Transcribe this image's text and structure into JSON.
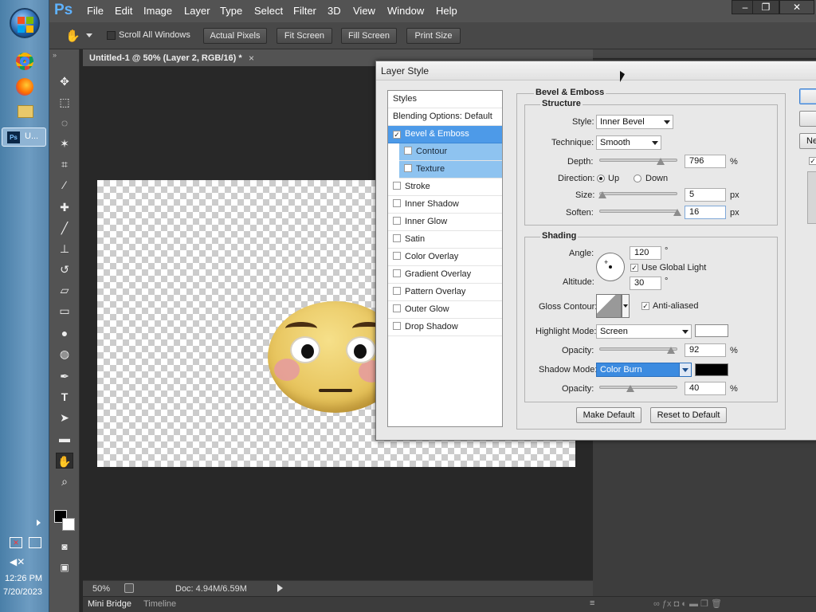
{
  "taskbar": {
    "task_label": "U...",
    "ps_badge": "Ps",
    "time": "12:26 PM",
    "date": "7/20/2023"
  },
  "app": {
    "logo": "Ps",
    "menus": [
      "File",
      "Edit",
      "Image",
      "Layer",
      "Type",
      "Select",
      "Filter",
      "3D",
      "View",
      "Window",
      "Help"
    ]
  },
  "options": {
    "scroll_all": "Scroll All Windows",
    "buttons": [
      "Actual Pixels",
      "Fit Screen",
      "Fill Screen",
      "Print Size"
    ]
  },
  "document": {
    "tab_title": "Untitled-1 @ 50% (Layer 2, RGB/16) *",
    "close": "×",
    "zoom": "50%",
    "doc_info": "Doc: 4.94M/6.59M"
  },
  "bottom_tabs": [
    "Mini Bridge",
    "Timeline"
  ],
  "dialog": {
    "title": "Layer Style",
    "list_header": "Styles",
    "blending": "Blending Options: Default",
    "items": [
      {
        "label": "Bevel & Emboss",
        "checked": "✓"
      },
      {
        "label": "Contour",
        "checked": ""
      },
      {
        "label": "Texture",
        "checked": ""
      },
      {
        "label": "Stroke",
        "checked": ""
      },
      {
        "label": "Inner Shadow",
        "checked": ""
      },
      {
        "label": "Inner Glow",
        "checked": ""
      },
      {
        "label": "Satin",
        "checked": ""
      },
      {
        "label": "Color Overlay",
        "checked": ""
      },
      {
        "label": "Gradient Overlay",
        "checked": ""
      },
      {
        "label": "Pattern Overlay",
        "checked": ""
      },
      {
        "label": "Outer Glow",
        "checked": ""
      },
      {
        "label": "Drop Shadow",
        "checked": ""
      }
    ],
    "section_title": "Bevel & Emboss",
    "structure": {
      "title": "Structure",
      "style_label": "Style:",
      "style_value": "Inner Bevel",
      "technique_label": "Technique:",
      "technique_value": "Smooth",
      "depth_label": "Depth:",
      "depth_value": "796",
      "depth_unit": "%",
      "direction_label": "Direction:",
      "up": "Up",
      "down": "Down",
      "size_label": "Size:",
      "size_value": "5",
      "size_unit": "px",
      "soften_label": "Soften:",
      "soften_value": "16",
      "soften_unit": "px"
    },
    "shading": {
      "title": "Shading",
      "angle_label": "Angle:",
      "angle_value": "120",
      "deg": "°",
      "global_light": "Use Global Light",
      "altitude_label": "Altitude:",
      "altitude_value": "30",
      "gloss_label": "Gloss Contour:",
      "anti_aliased": "Anti-aliased",
      "highlight_label": "Highlight Mode:",
      "highlight_value": "Screen",
      "hl_opacity_label": "Opacity:",
      "hl_opacity_value": "92",
      "pct": "%",
      "shadow_label": "Shadow Mode:",
      "shadow_value": "Color Burn",
      "sh_opacity_label": "Opacity:",
      "sh_opacity_value": "40"
    },
    "make_default": "Make Default",
    "reset_default": "Reset to Default",
    "right_btn_partial": "Ne",
    "colors": {
      "highlight": "#ffffff",
      "shadow": "#000000"
    }
  }
}
